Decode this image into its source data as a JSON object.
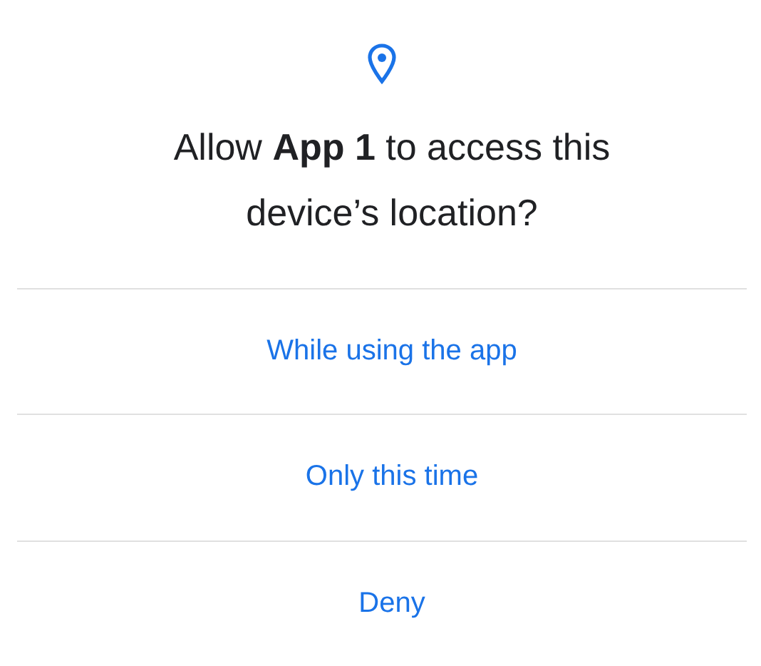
{
  "dialog": {
    "title": "Allow **App 1** to access this device’s location?",
    "options": [
      {
        "label": "While using the app"
      },
      {
        "label": "Only this time"
      },
      {
        "label": "Deny"
      }
    ]
  }
}
